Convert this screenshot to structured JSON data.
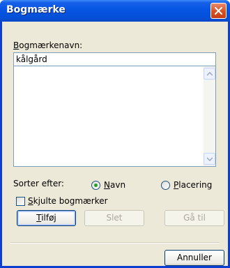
{
  "window": {
    "title": "Bogmærke"
  },
  "bookmark_name": {
    "label_underlined": "B",
    "label_rest": "ogmærkenavn:",
    "value": "kålgård"
  },
  "sort": {
    "label": "Sorter efter:",
    "options": [
      {
        "u": "N",
        "rest": "avn",
        "selected": true
      },
      {
        "u": "P",
        "rest": "lacering",
        "selected": false
      }
    ]
  },
  "hidden_bookmarks": {
    "u": "S",
    "rest": "kjulte bogmærker",
    "checked": false
  },
  "buttons": {
    "add": {
      "u": "T",
      "rest": "ilføj"
    },
    "delete": "Slet",
    "goto": "Gå til",
    "cancel": "Annuller"
  },
  "colors": {
    "titlebar": "#0655e4",
    "dialog_bg": "#ece9d8",
    "close": "#d9501f",
    "radio_dot": "#21a121"
  },
  "icons": [
    "close-icon",
    "scroll-up-arrow-icon",
    "scroll-down-arrow-icon"
  ]
}
